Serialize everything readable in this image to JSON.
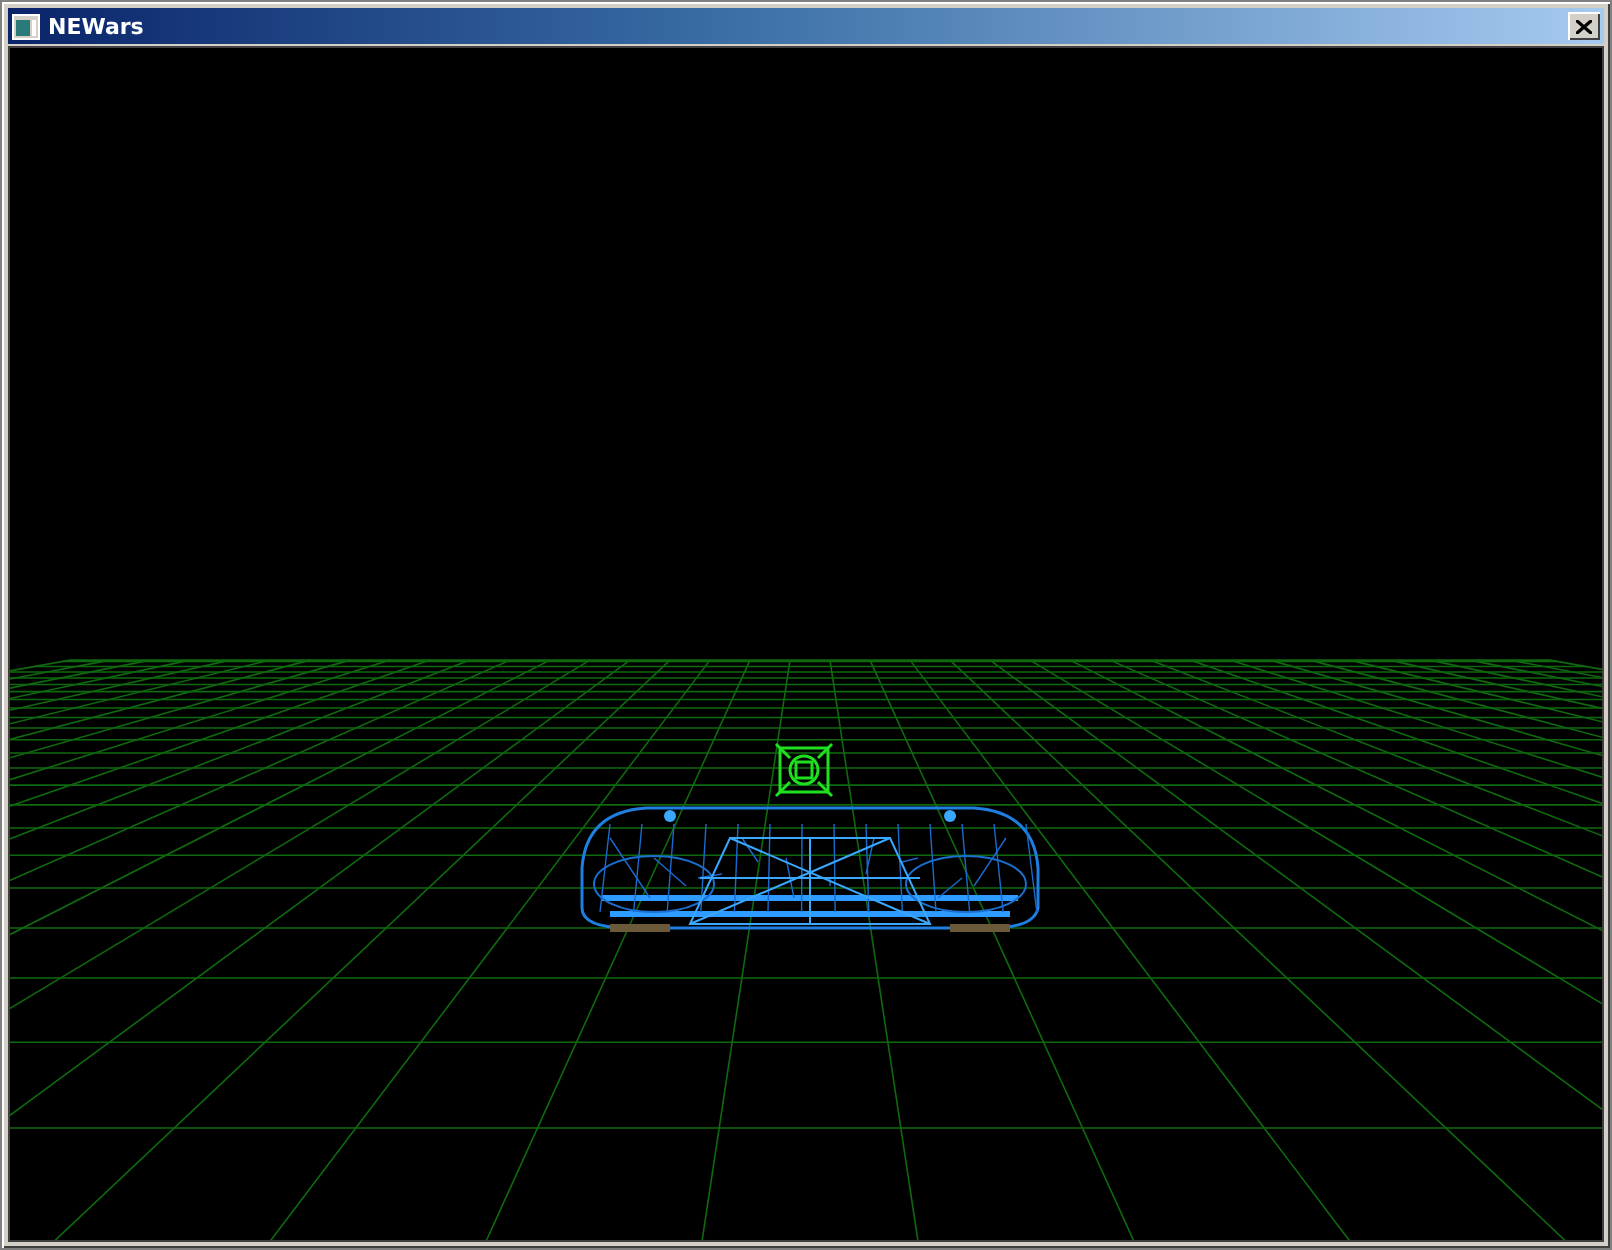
{
  "window": {
    "title": "NEWars"
  }
}
